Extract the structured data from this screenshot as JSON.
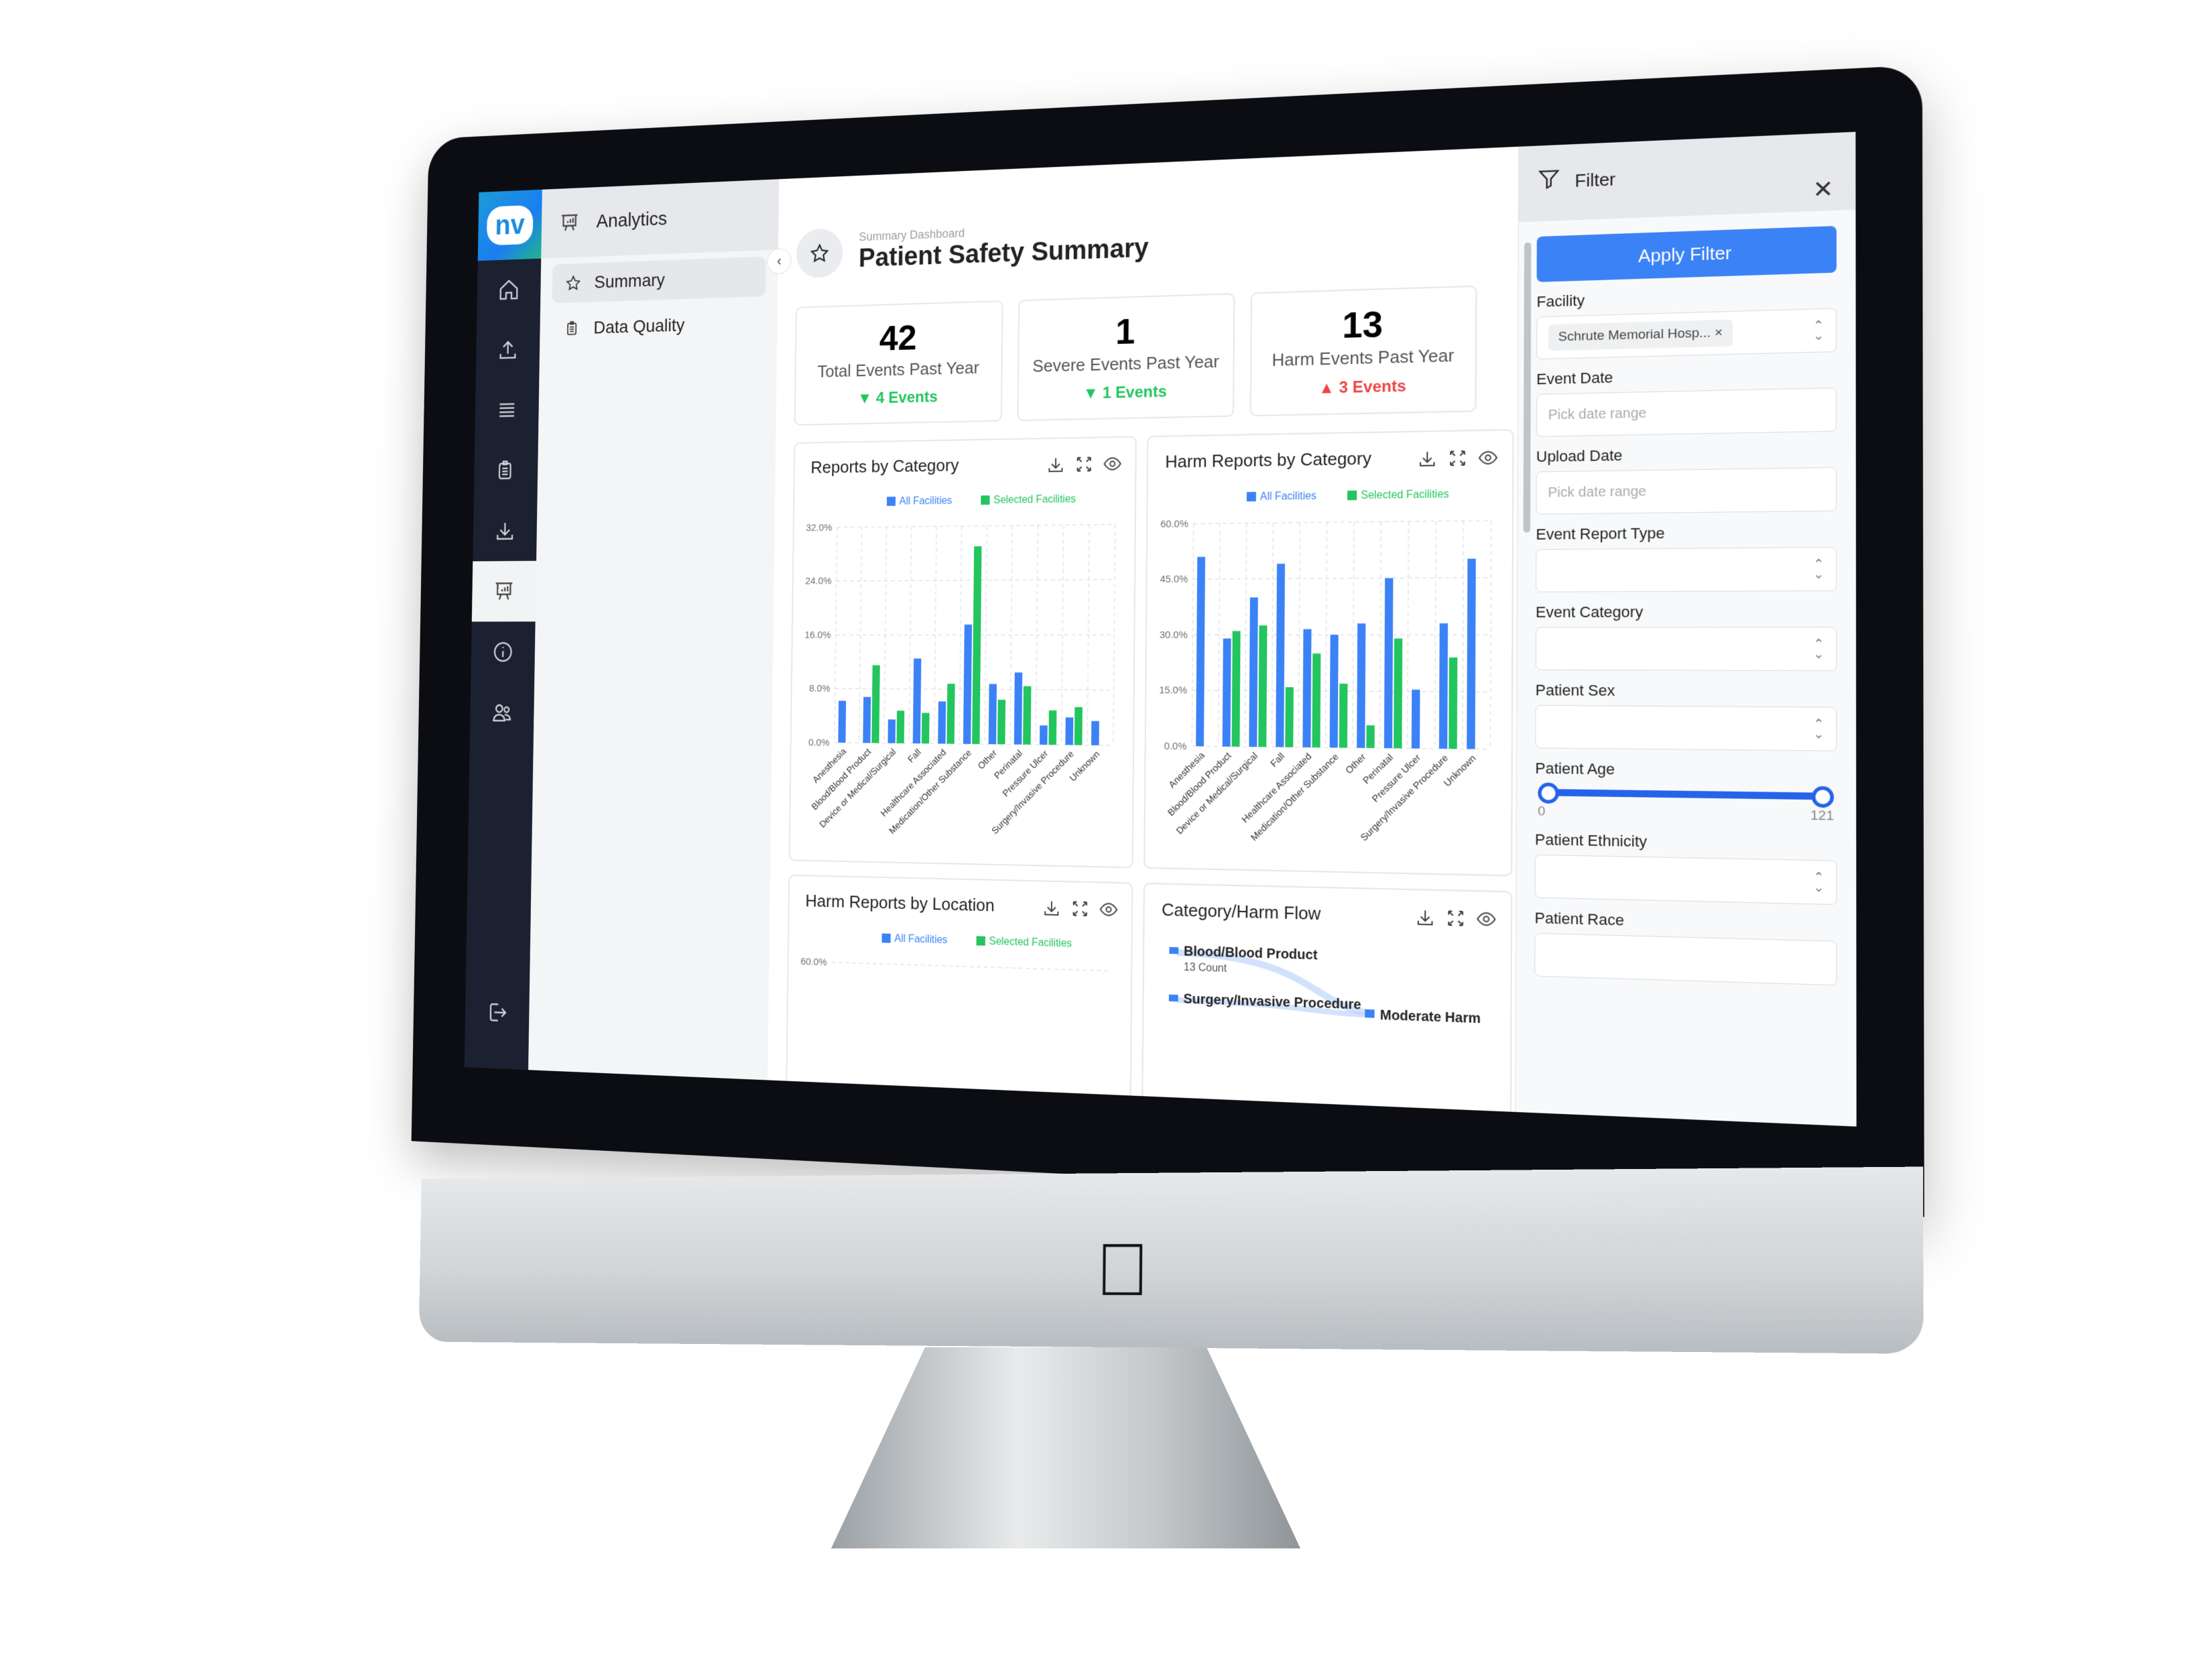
{
  "app": {
    "logo_text": "nv",
    "brand_color": "#1a8be0"
  },
  "rail": {
    "items": [
      {
        "icon": "home-icon",
        "active": false
      },
      {
        "icon": "upload-icon",
        "active": false
      },
      {
        "icon": "list-icon",
        "active": false
      },
      {
        "icon": "clipboard-icon",
        "active": false
      },
      {
        "icon": "download-icon",
        "active": false
      },
      {
        "icon": "analytics-icon",
        "active": true
      },
      {
        "icon": "info-icon",
        "active": false
      },
      {
        "icon": "users-icon",
        "active": false
      }
    ],
    "bottom_icon": "logout-icon"
  },
  "submenu": {
    "title": "Analytics",
    "items": [
      {
        "label": "Summary",
        "icon": "star-icon",
        "active": true
      },
      {
        "label": "Data Quality",
        "icon": "clipboard-icon",
        "active": false
      }
    ]
  },
  "header": {
    "breadcrumb": "Summary Dashboard",
    "title": "Patient Safety Summary"
  },
  "kpis": [
    {
      "value": "42",
      "label": "Total Events Past Year",
      "delta": "4 Events",
      "direction": "down"
    },
    {
      "value": "1",
      "label": "Severe Events Past Year",
      "delta": "1 Events",
      "direction": "down"
    },
    {
      "value": "13",
      "label": "Harm Events Past Year",
      "delta": "3 Events",
      "direction": "up"
    }
  ],
  "colors": {
    "all_facilities": "#3b82f6",
    "selected_facilities": "#22c55e",
    "down": "#22c55e",
    "up": "#ef4444",
    "apply_button": "#3b82f6"
  },
  "chart_data": [
    {
      "type": "bar",
      "title": "Reports by Category",
      "legend": [
        "All Facilities",
        "Selected Facilities"
      ],
      "legend_position": "top-right",
      "grid": true,
      "yticks": [
        "0.0%",
        "8.0%",
        "16.0%",
        "24.0%",
        "32.0%"
      ],
      "ylim": [
        0,
        32
      ],
      "categories": [
        "Anesthesia",
        "Blood/Blood Product",
        "Device or Medical/Surgical",
        "Fall",
        "Healthcare Associated",
        "Medication/Other Substance",
        "Other",
        "Perinatal",
        "Pressure Ulcer",
        "Surgery/Invasive Procedure",
        "Unknown"
      ],
      "series": [
        {
          "name": "All Facilities",
          "values": [
            6.2,
            6.8,
            3.5,
            12.5,
            6.2,
            17.5,
            8.8,
            10.5,
            2.8,
            4.0,
            3.5
          ]
        },
        {
          "name": "Selected Facilities",
          "values": [
            0,
            11.5,
            4.8,
            4.5,
            8.8,
            29.0,
            6.5,
            8.5,
            5.0,
            5.5,
            0
          ]
        }
      ]
    },
    {
      "type": "bar",
      "title": "Harm Reports by Category",
      "legend": [
        "All Facilities",
        "Selected Facilities"
      ],
      "legend_position": "top-right",
      "grid": true,
      "yticks": [
        "0.0%",
        "15.0%",
        "30.0%",
        "45.0%",
        "60.0%"
      ],
      "ylim": [
        0,
        60
      ],
      "categories": [
        "Anesthesia",
        "Blood/Blood Product",
        "Device or Medical/Surgical",
        "Fall",
        "Healthcare Associated",
        "Medication/Other Substance",
        "Other",
        "Perinatal",
        "Pressure Ulcer",
        "Surgery/Invasive Procedure",
        "Unknown"
      ],
      "series": [
        {
          "name": "All Facilities",
          "values": [
            51,
            29,
            40,
            49,
            31.5,
            30,
            33,
            45,
            15.5,
            33,
            50
          ]
        },
        {
          "name": "Selected Facilities",
          "values": [
            0,
            31,
            32.5,
            16,
            25,
            17,
            6,
            29,
            0,
            24,
            0
          ]
        }
      ]
    },
    {
      "type": "bar",
      "title": "Harm Reports by Location",
      "legend": [
        "All Facilities",
        "Selected Facilities"
      ],
      "legend_position": "top-right",
      "grid": true,
      "yticks": [
        "60.0%"
      ],
      "ylim": [
        0,
        60
      ]
    },
    {
      "type": "sankey",
      "title": "Category/Harm Flow",
      "nodes": [
        {
          "label": "Blood/Blood Product",
          "sublabel": "13 Count"
        },
        {
          "label": "Surgery/Invasive Procedure"
        },
        {
          "label": "Moderate Harm"
        }
      ]
    }
  ],
  "card_tools": [
    "download-icon",
    "expand-icon",
    "eye-icon"
  ],
  "filter": {
    "title": "Filter",
    "apply_label": "Apply Filter",
    "fields": {
      "facility": {
        "label": "Facility",
        "chip": "Schrute Memorial Hosp..."
      },
      "event_date": {
        "label": "Event Date",
        "placeholder": "Pick date range"
      },
      "upload_date": {
        "label": "Upload Date",
        "placeholder": "Pick date range"
      },
      "event_report_type": {
        "label": "Event Report Type"
      },
      "event_category": {
        "label": "Event Category"
      },
      "patient_sex": {
        "label": "Patient Sex"
      },
      "patient_age": {
        "label": "Patient Age",
        "min": "0",
        "max": "121",
        "range_low": 0,
        "range_high": 121
      },
      "patient_ethnicity": {
        "label": "Patient Ethnicity"
      },
      "patient_race": {
        "label": "Patient Race"
      }
    }
  }
}
